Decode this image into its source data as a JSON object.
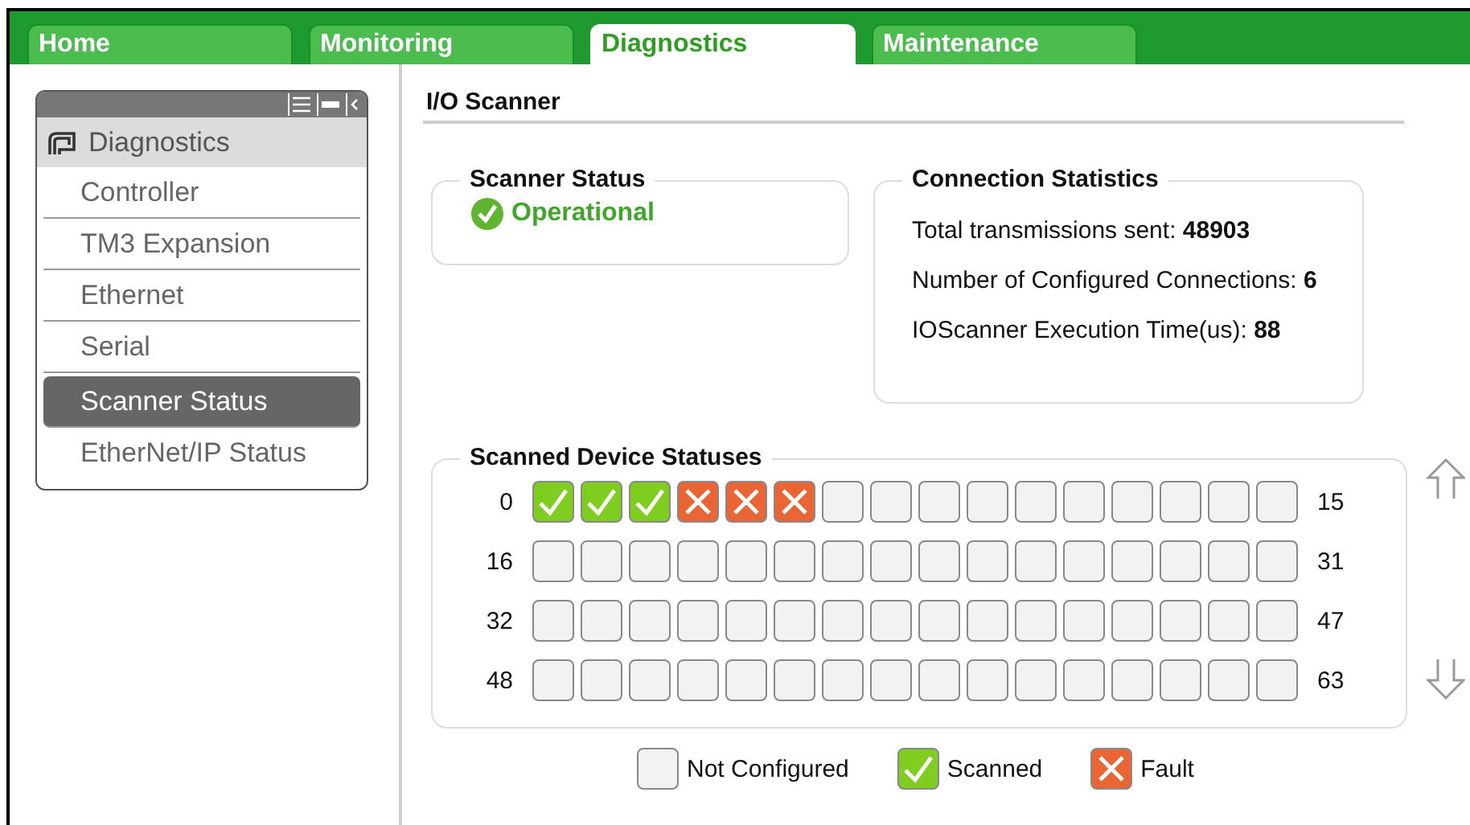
{
  "tabs": [
    {
      "label": "Home",
      "selected": false
    },
    {
      "label": "Monitoring",
      "selected": false
    },
    {
      "label": "Diagnostics",
      "selected": true
    },
    {
      "label": "Maintenance",
      "selected": false
    }
  ],
  "sidebar": {
    "title": "Diagnostics",
    "items": [
      {
        "label": "Controller",
        "selected": false
      },
      {
        "label": "TM3 Expansion",
        "selected": false
      },
      {
        "label": "Ethernet",
        "selected": false
      },
      {
        "label": "Serial",
        "selected": false
      },
      {
        "label": "Scanner Status",
        "selected": true
      },
      {
        "label": "EtherNet/IP Status",
        "selected": false
      }
    ]
  },
  "page_title": "I/O Scanner",
  "scanner_status": {
    "title": "Scanner Status",
    "status": "Operational",
    "kind": "ok"
  },
  "connection_statistics": {
    "title": "Connection Statistics",
    "lines": [
      "Total transmissions sent: **48903**",
      "Number of Configured Connections: **6**",
      "IOScanner Execution Time(us): **88**"
    ]
  },
  "device_statuses": {
    "title": "Scanned Device Statuses",
    "rows": [
      {
        "start": "0",
        "end": "15",
        "cells": [
          {
            "kind": "scanned"
          },
          {
            "kind": "scanned"
          },
          {
            "kind": "scanned"
          },
          {
            "kind": "fault"
          },
          {
            "kind": "fault"
          },
          {
            "kind": "fault"
          },
          {
            "kind": "none"
          },
          {
            "kind": "none"
          },
          {
            "kind": "none"
          },
          {
            "kind": "none"
          },
          {
            "kind": "none"
          },
          {
            "kind": "none"
          },
          {
            "kind": "none"
          },
          {
            "kind": "none"
          },
          {
            "kind": "none"
          },
          {
            "kind": "none"
          }
        ]
      },
      {
        "start": "16",
        "end": "31",
        "cells": [
          {
            "kind": "none"
          },
          {
            "kind": "none"
          },
          {
            "kind": "none"
          },
          {
            "kind": "none"
          },
          {
            "kind": "none"
          },
          {
            "kind": "none"
          },
          {
            "kind": "none"
          },
          {
            "kind": "none"
          },
          {
            "kind": "none"
          },
          {
            "kind": "none"
          },
          {
            "kind": "none"
          },
          {
            "kind": "none"
          },
          {
            "kind": "none"
          },
          {
            "kind": "none"
          },
          {
            "kind": "none"
          },
          {
            "kind": "none"
          }
        ]
      },
      {
        "start": "32",
        "end": "47",
        "cells": [
          {
            "kind": "none"
          },
          {
            "kind": "none"
          },
          {
            "kind": "none"
          },
          {
            "kind": "none"
          },
          {
            "kind": "none"
          },
          {
            "kind": "none"
          },
          {
            "kind": "none"
          },
          {
            "kind": "none"
          },
          {
            "kind": "none"
          },
          {
            "kind": "none"
          },
          {
            "kind": "none"
          },
          {
            "kind": "none"
          },
          {
            "kind": "none"
          },
          {
            "kind": "none"
          },
          {
            "kind": "none"
          },
          {
            "kind": "none"
          }
        ]
      },
      {
        "start": "48",
        "end": "63",
        "cells": [
          {
            "kind": "none"
          },
          {
            "kind": "none"
          },
          {
            "kind": "none"
          },
          {
            "kind": "none"
          },
          {
            "kind": "none"
          },
          {
            "kind": "none"
          },
          {
            "kind": "none"
          },
          {
            "kind": "none"
          },
          {
            "kind": "none"
          },
          {
            "kind": "none"
          },
          {
            "kind": "none"
          },
          {
            "kind": "none"
          },
          {
            "kind": "none"
          },
          {
            "kind": "none"
          },
          {
            "kind": "none"
          },
          {
            "kind": "none"
          }
        ]
      }
    ]
  },
  "legend": [
    {
      "kind": "none",
      "label": "Not Configured"
    },
    {
      "kind": "scanned",
      "label": "Scanned"
    },
    {
      "kind": "fault",
      "label": "Fault"
    }
  ]
}
